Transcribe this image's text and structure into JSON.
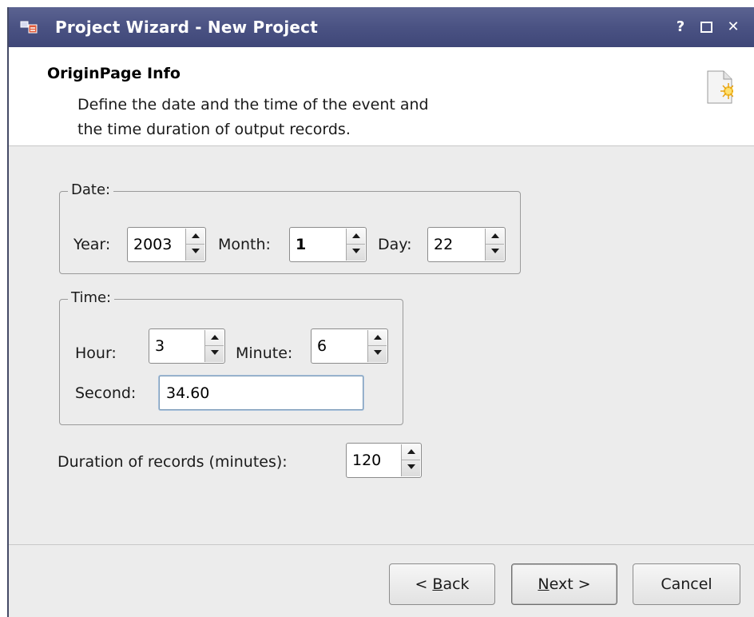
{
  "window": {
    "title": "Project Wizard - New Project",
    "help_label": "?",
    "close_label": "✕"
  },
  "header": {
    "title": "OriginPage Info",
    "description_line1": "Define the date and the time of the event and",
    "description_line2": "the time duration of output records."
  },
  "date_group": {
    "legend": "Date:",
    "year_label": "Year:",
    "year_value": "2003",
    "month_label": "Month:",
    "month_value": "1",
    "day_label": "Day:",
    "day_value": "22"
  },
  "time_group": {
    "legend": "Time:",
    "hour_label": "Hour:",
    "hour_value": "3",
    "minute_label": "Minute:",
    "minute_value": "6",
    "second_label": "Second:",
    "second_value": "34.60"
  },
  "duration": {
    "label": "Duration of records (minutes):",
    "value": "120"
  },
  "buttons": {
    "back_prefix": "< ",
    "back_mnemonic": "B",
    "back_rest": "ack",
    "next_mnemonic": "N",
    "next_rest": "ext >",
    "cancel": "Cancel"
  },
  "colors": {
    "titlebar": "#4a5283",
    "window_bg": "#ececec",
    "header_bg": "#ffffff",
    "field_focus_border": "#7f9db9"
  },
  "icons": {
    "app": "wizard-app-icon",
    "header": "new-document-icon"
  }
}
